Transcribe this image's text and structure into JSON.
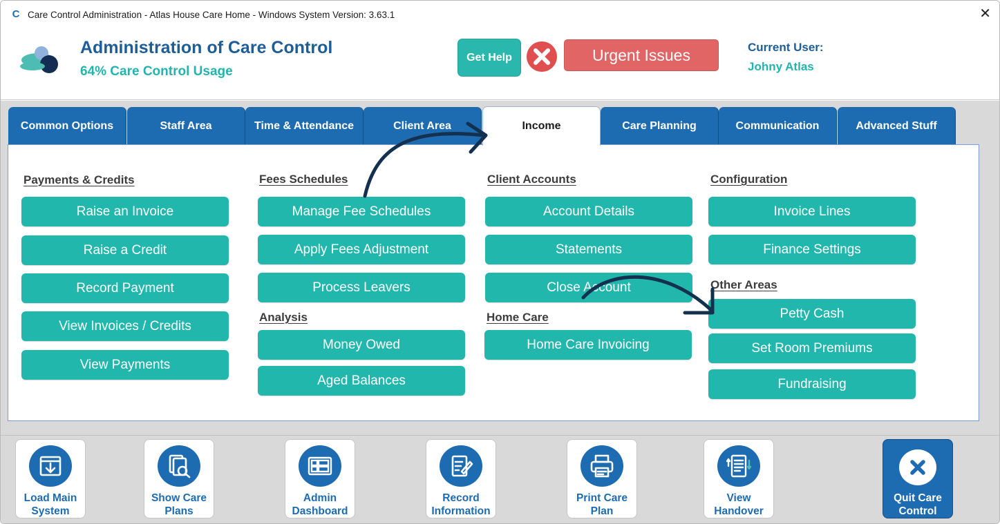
{
  "window": {
    "title": "Care Control Administration - Atlas House Care Home - Windows System Version: 3.63.1",
    "close_glyph": "✕"
  },
  "header": {
    "title": "Administration of Care Control",
    "usage": "64% Care Control Usage",
    "get_help": "Get Help",
    "urgent_issues": "Urgent Issues",
    "current_user_label": "Current User:",
    "current_user_name": "Johny Atlas"
  },
  "tabs": [
    {
      "label": "Common Options"
    },
    {
      "label": "Staff Area"
    },
    {
      "label": "Time & Attendance"
    },
    {
      "label": "Client Area"
    },
    {
      "label": "Income"
    },
    {
      "label": "Care Planning"
    },
    {
      "label": "Communication"
    },
    {
      "label": "Advanced Stuff"
    }
  ],
  "active_tab": "Income",
  "sections": {
    "payments": {
      "title": "Payments & Credits",
      "buttons": [
        "Raise an Invoice",
        "Raise a Credit",
        "Record Payment",
        "View Invoices / Credits",
        "View Payments"
      ]
    },
    "fees": {
      "title": "Fees Schedules",
      "buttons": [
        "Manage Fee Schedules",
        "Apply Fees Adjustment",
        "Process Leavers"
      ]
    },
    "analysis": {
      "title": "Analysis",
      "buttons": [
        "Money Owed",
        "Aged Balances"
      ]
    },
    "client_accounts": {
      "title": "Client Accounts",
      "buttons": [
        "Account Details",
        "Statements",
        "Close Account"
      ]
    },
    "home_care": {
      "title": "Home Care",
      "buttons": [
        "Home Care Invoicing"
      ]
    },
    "configuration": {
      "title": "Configuration",
      "buttons": [
        "Invoice Lines",
        "Finance Settings"
      ]
    },
    "other_areas": {
      "title": "Other Areas",
      "buttons": [
        "Petty Cash",
        "Set Room Premiums",
        "Fundraising"
      ]
    }
  },
  "toolbar": [
    {
      "line1": "Load Main",
      "line2": "System",
      "icon": "download-tray-icon"
    },
    {
      "line1": "Show Care",
      "line2": "Plans",
      "icon": "document-search-icon"
    },
    {
      "line1": "Admin",
      "line2": "Dashboard",
      "icon": "dashboard-grid-icon"
    },
    {
      "line1": "Record",
      "line2": "Information",
      "icon": "edit-document-icon"
    },
    {
      "line1": "Print Care",
      "line2": "Plan",
      "icon": "printer-icon"
    },
    {
      "line1": "View",
      "line2": "Handover",
      "icon": "handover-list-icon"
    },
    {
      "line1": "Quit Care",
      "line2": "Control",
      "icon": "close-circle-icon"
    }
  ],
  "colors": {
    "teal": "#22b7ad",
    "blue": "#1d6bb0",
    "red": "#e26565",
    "arrow": "#14304f"
  }
}
